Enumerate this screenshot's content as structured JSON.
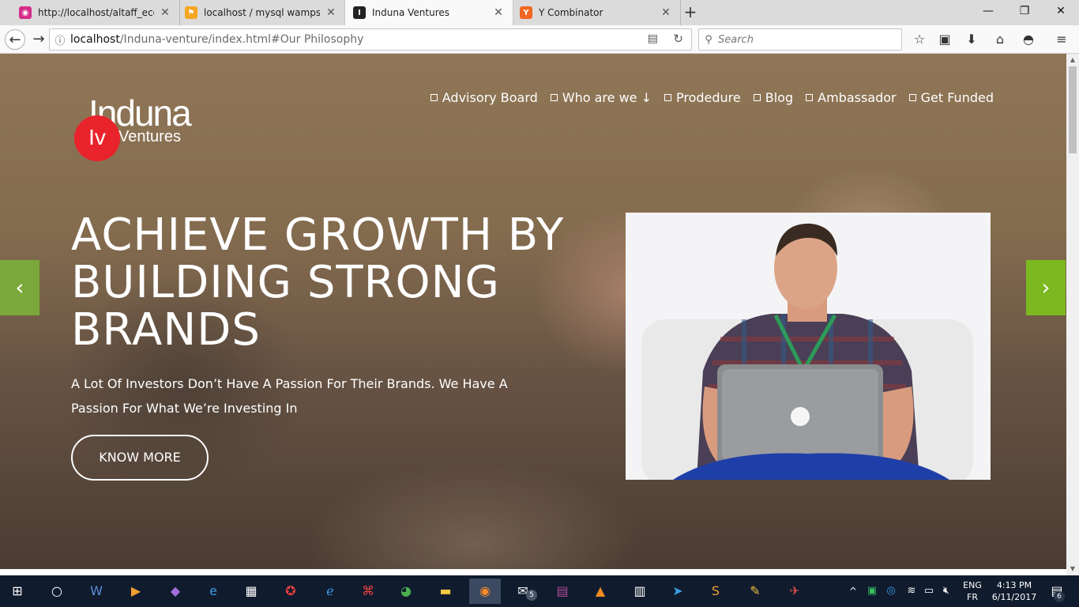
{
  "browser": {
    "tabs": [
      {
        "title": "http://localhost/altaff_ecom",
        "icon": "localhost-icon",
        "color": "#d62d8a"
      },
      {
        "title": "localhost / mysql wampserv",
        "icon": "phpmyadmin-icon",
        "color": "#e68a00"
      },
      {
        "title": "Induna Ventures",
        "icon": "induna-icon",
        "color": "#222222"
      },
      {
        "title": "Y Combinator",
        "icon": "ycombinator-icon",
        "color": "#f26522"
      }
    ],
    "new_tab": "+",
    "window_controls": {
      "minimize": "—",
      "restore": "❐",
      "close": "✕"
    },
    "url_host": "localhost",
    "url_path": "/Induna-venture/index.html#Our Philosophy",
    "search_placeholder": "Search"
  },
  "site": {
    "logo_word": "Induna",
    "logo_sub": "Ventures",
    "logo_badge": "Iv",
    "menu": [
      "Advisory Board",
      "Who are we ↓",
      "Prodedure",
      "Blog",
      "Ambassador",
      "Get Funded"
    ],
    "hero_title": "ACHIEVE GROWTH BY BUILDING STRONG BRANDS",
    "hero_subtitle": "A Lot Of Investors Don’t Have A Passion For Their Brands. We Have A Passion For What We’re Investing In",
    "hero_button": "KNOW MORE",
    "prev_arrow": "‹",
    "next_arrow": "›",
    "accent_color": "#7cb81f"
  },
  "taskbar": {
    "notification_badge": "5",
    "language_top": "ENG",
    "language_bottom": "FR",
    "time": "4:13 PM",
    "date": "6/11/2017",
    "action_center_count": "6"
  }
}
